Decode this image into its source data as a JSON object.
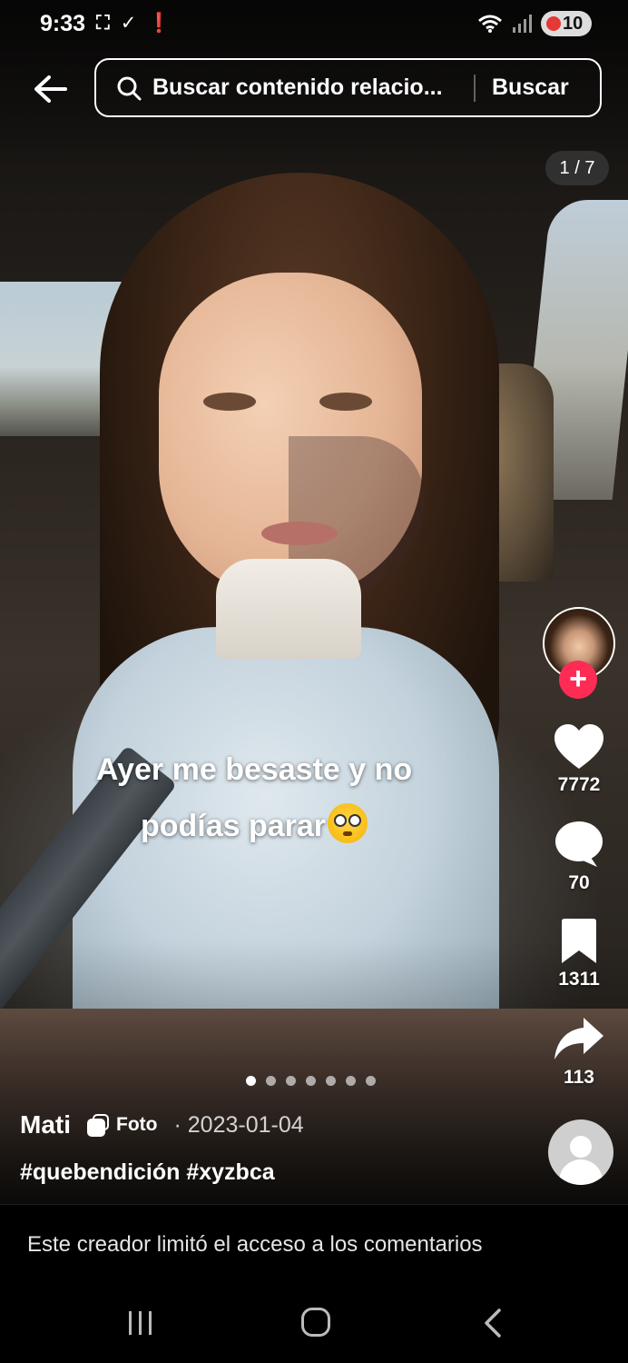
{
  "status_bar": {
    "time": "9:33",
    "battery": "10",
    "left_icons": [
      "screenshot-icon",
      "check-icon",
      "alert-icon"
    ],
    "right_icons": [
      "wifi-icon",
      "signal-icon",
      "battery-icon"
    ]
  },
  "search": {
    "query": "Buscar contenido relacio...",
    "button_label": "Buscar"
  },
  "carousel": {
    "counter": "1 / 7",
    "total": 7,
    "current": 1
  },
  "caption": {
    "line1": "Ayer me besaste y no",
    "line2": "podías parar",
    "emoji": "flushed-face"
  },
  "actions": {
    "likes": "7772",
    "comments": "70",
    "saves": "1311",
    "shares": "113"
  },
  "post": {
    "author": "Mati",
    "type_label": "Foto",
    "date": "· 2023-01-04",
    "hashtags": "#quebendición #xyzbca"
  },
  "comments_notice": "Este creador limitó el acceso a los comentarios",
  "colors": {
    "follow_accent": "#fe2c55",
    "battery_low": "#e53935"
  }
}
